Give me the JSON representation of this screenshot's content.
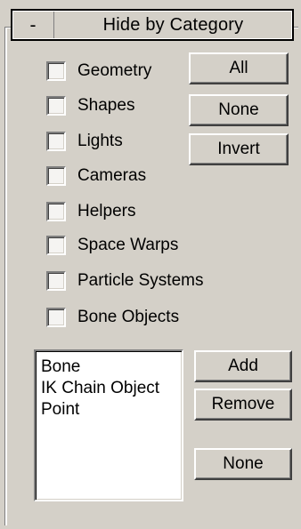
{
  "rollout": {
    "toggle": "-",
    "title": "Hide by Category"
  },
  "categories": [
    {
      "label": "Geometry",
      "checked": false
    },
    {
      "label": "Shapes",
      "checked": false
    },
    {
      "label": "Lights",
      "checked": false
    },
    {
      "label": "Cameras",
      "checked": false
    },
    {
      "label": "Helpers",
      "checked": false
    },
    {
      "label": "Space Warps",
      "checked": false
    },
    {
      "label": "Particle Systems",
      "checked": false
    },
    {
      "label": "Bone Objects",
      "checked": false
    }
  ],
  "buttons": {
    "all": "All",
    "none": "None",
    "invert": "Invert",
    "add": "Add",
    "remove": "Remove",
    "none_list": "None"
  },
  "list": {
    "items": [
      "Bone",
      "IK Chain Object",
      "Point"
    ]
  }
}
